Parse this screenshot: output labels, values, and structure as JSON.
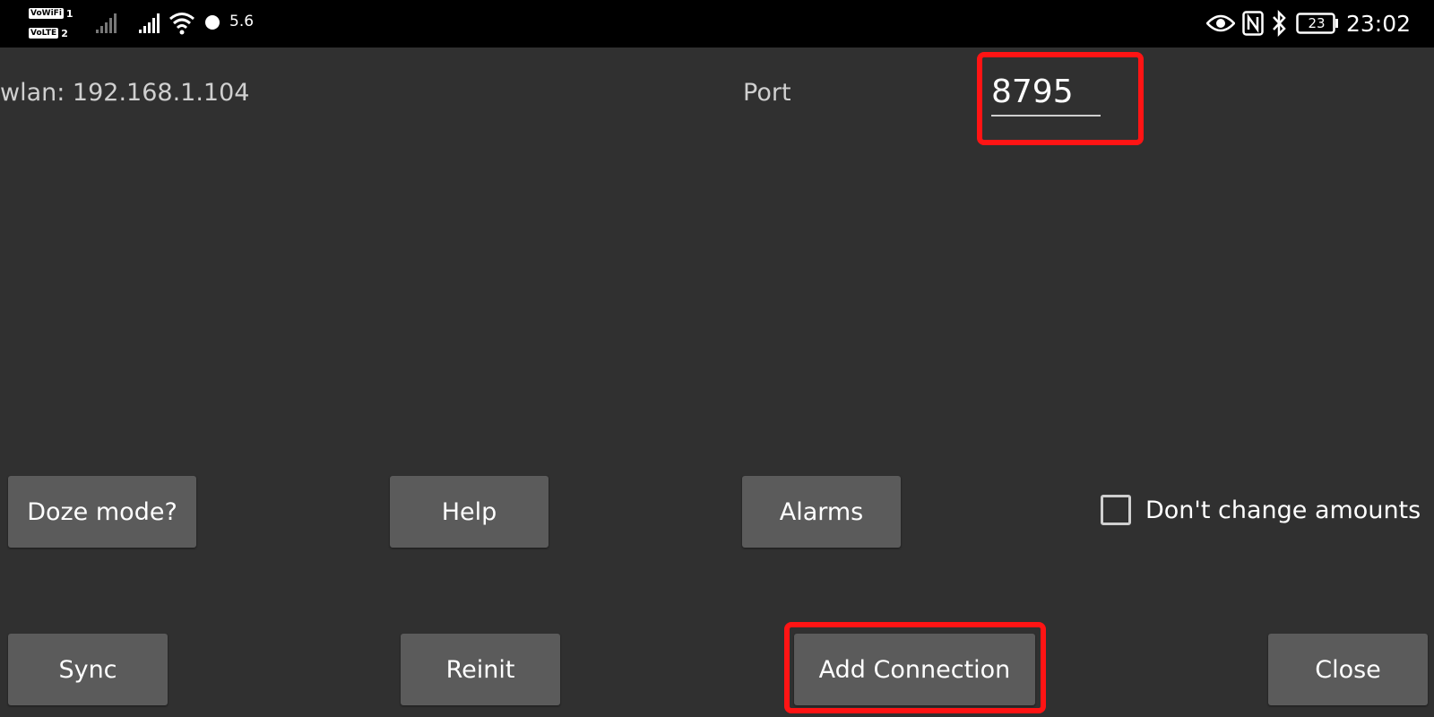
{
  "status_bar": {
    "sim1_badge": "VoWiFi",
    "sim1_number": "1",
    "sim2_badge": "VoLTE",
    "sim2_number": "2",
    "network_speed": "5.6",
    "battery_level": "23",
    "time": "23:02",
    "icons": [
      "signal-icon",
      "signal-icon",
      "wifi-icon",
      "notification-dot-icon",
      "eye-icon",
      "nfc-icon",
      "bluetooth-icon",
      "battery-icon"
    ]
  },
  "main": {
    "wlan_label": "wlan: 192.168.1.104",
    "port_label": "Port",
    "port_value": "8795"
  },
  "buttons": {
    "doze": "Doze mode?",
    "help": "Help",
    "alarms": "Alarms",
    "sync": "Sync",
    "reinit": "Reinit",
    "add_connection": "Add Connection",
    "close": "Close"
  },
  "checkbox": {
    "label": "Don't change amounts",
    "checked": false
  },
  "colors": {
    "background": "#303030",
    "status_bar": "#000000",
    "button": "#5b5b5b",
    "highlight": "#ff1414",
    "text": "#ffffff",
    "label_text": "#cfcfcf"
  }
}
